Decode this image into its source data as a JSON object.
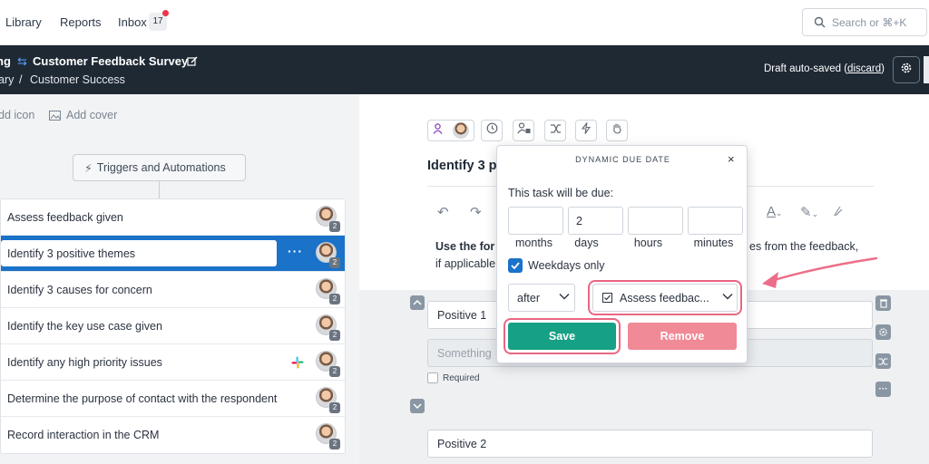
{
  "nav": {
    "items": [
      "Library",
      "Reports",
      "Inbox"
    ],
    "inbox_count": "17",
    "search_placeholder": "Search or ⌘+K"
  },
  "header": {
    "section_fragment": "ng",
    "title": "Customer Feedback Survey",
    "breadcrumb": [
      "ary",
      "/",
      "Customer Success"
    ],
    "draft_text": "Draft auto-saved (",
    "discard": "discard",
    "draft_close": ")"
  },
  "left": {
    "add_icon": "dd icon",
    "add_cover": "Add cover",
    "triggers": "Triggers and Automations",
    "tasks": [
      {
        "label": "Assess feedback given",
        "badge": "2"
      },
      {
        "label": "Identify 3 positive themes",
        "badge": "2",
        "selected": true,
        "menu": "···"
      },
      {
        "label": "Identify 3 causes for concern",
        "badge": "2"
      },
      {
        "label": "Identify the key use case given",
        "badge": "2"
      },
      {
        "label": "Identify any high priority issues",
        "badge": "2",
        "slack": true
      },
      {
        "label": "Determine the purpose of contact with the respondent",
        "badge": "2"
      },
      {
        "label": "Record interaction in the CRM",
        "badge": "2"
      }
    ]
  },
  "editor": {
    "task_title": "Identify 3 p",
    "desc_bold": "Use the for",
    "desc_line2": "if applicable",
    "desc_right": "es from the feedback,",
    "fields": [
      "Positive 1",
      "Something",
      "Positive 2"
    ],
    "required_label": "Required"
  },
  "popup": {
    "title": "DYNAMIC DUE DATE",
    "close": "×",
    "due_label": "This task will be due:",
    "inputs": [
      {
        "value": "",
        "unit": "months"
      },
      {
        "value": "2",
        "unit": "days"
      },
      {
        "value": "",
        "unit": "hours"
      },
      {
        "value": "",
        "unit": "minutes"
      }
    ],
    "weekdays_label": "Weekdays only",
    "weekdays_checked": true,
    "relation": "after",
    "reference": "Assess feedbac...",
    "save": "Save",
    "remove": "Remove"
  },
  "colors": {
    "header_bg": "#1f2934",
    "selected_task": "#1a72c9",
    "save_green": "#16a085",
    "remove_pink": "#f08a96",
    "highlight_ring": "#e96683"
  }
}
